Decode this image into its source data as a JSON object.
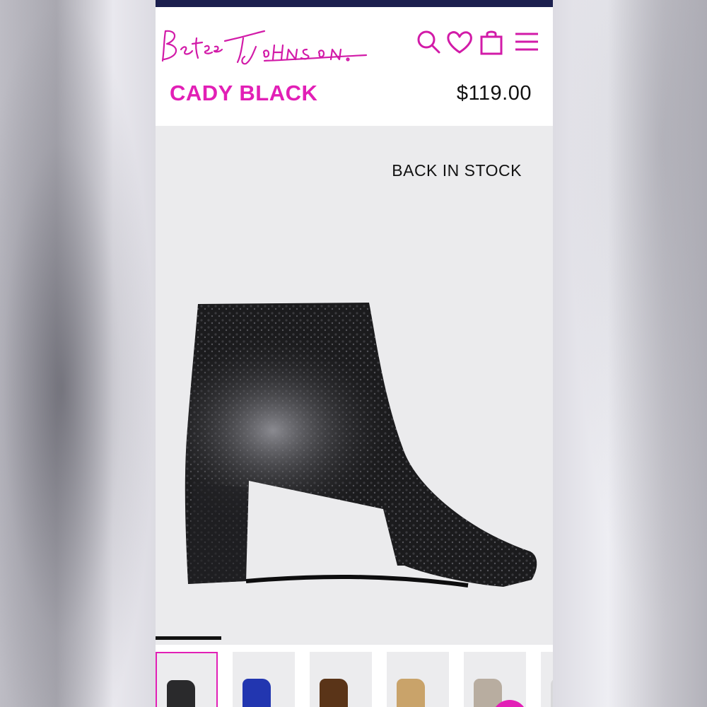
{
  "brand": {
    "logo_text": "Betsey Johnson",
    "accent_color": "#e21fb6",
    "nav_color": "#1b1f4e"
  },
  "header": {
    "icons": [
      "search-icon",
      "heart-icon",
      "shopping-bag-icon",
      "menu-icon"
    ]
  },
  "product": {
    "name": "CADY BLACK",
    "price": "$119.00",
    "stock_status": "BACK IN STOCK"
  },
  "gallery": {
    "progress": 0.17,
    "thumbnails": [
      {
        "name": "black",
        "color": "#2a2a2c",
        "selected": true
      },
      {
        "name": "blue",
        "color": "#2236b0",
        "selected": false
      },
      {
        "name": "bronze",
        "color": "#5a3418",
        "selected": false
      },
      {
        "name": "gold",
        "color": "#c9a36a",
        "selected": false
      },
      {
        "name": "silver",
        "color": "#b8ada0",
        "selected": false
      },
      {
        "name": "white",
        "color": "#d8d8da",
        "selected": false
      }
    ]
  }
}
